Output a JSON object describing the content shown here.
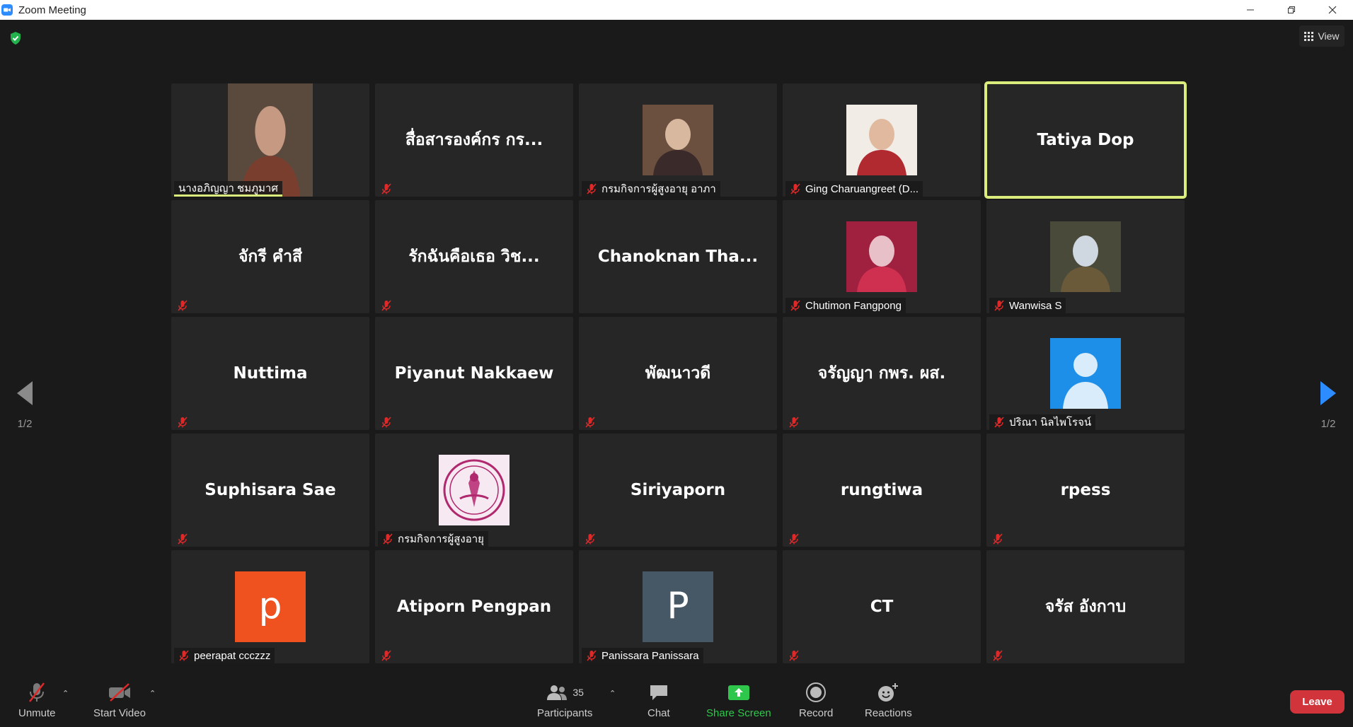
{
  "window": {
    "title": "Zoom Meeting"
  },
  "top": {
    "view_label": "View"
  },
  "pagination": {
    "prev_page": "1/2",
    "next_page": "1/2"
  },
  "tiles": [
    {
      "type": "video",
      "label": "นางอภิญญา ชมภูมาศ",
      "muted": false
    },
    {
      "type": "name",
      "name": "สื่อสารองค์กร กร...",
      "muted": true
    },
    {
      "type": "video",
      "label": "กรมกิจการผู้สูงอายุ อาภา",
      "muted": true
    },
    {
      "type": "video",
      "label": "Ging Charuangreet (D...",
      "muted": true
    },
    {
      "type": "name",
      "name": "Tatiya Dop",
      "muted": false,
      "active": true
    },
    {
      "type": "name",
      "name": "จักรี คำสี",
      "muted": true
    },
    {
      "type": "name",
      "name": "รักฉันคือเธอ วิช...",
      "muted": true
    },
    {
      "type": "name",
      "name": "Chanoknan  Tha...",
      "muted": false
    },
    {
      "type": "video",
      "label": "Chutimon Fangpong",
      "muted": true
    },
    {
      "type": "video",
      "label": "Wanwisa S",
      "muted": true
    },
    {
      "type": "name",
      "name": "Nuttima",
      "muted": true
    },
    {
      "type": "name",
      "name": "Piyanut Nakkaew",
      "muted": true
    },
    {
      "type": "name",
      "name": "พัฒนาวดี",
      "muted": true
    },
    {
      "type": "name",
      "name": "จรัญญา  กพร. ผส.",
      "muted": true
    },
    {
      "type": "avatar-default",
      "label": "ปริณา นิลไพโรจน์",
      "muted": true
    },
    {
      "type": "name",
      "name": "Suphisara Sae",
      "muted": true
    },
    {
      "type": "logo",
      "label": "กรมกิจการผู้สูงอายุ",
      "muted": true
    },
    {
      "type": "name",
      "name": "Siriyaporn",
      "muted": true
    },
    {
      "type": "name",
      "name": "rungtiwa",
      "muted": true
    },
    {
      "type": "name",
      "name": "rpess",
      "muted": true
    },
    {
      "type": "letter",
      "letter": "p",
      "color": "#f0521f",
      "label": "peerapat ccczzz",
      "muted": true
    },
    {
      "type": "name",
      "name": "Atiporn Pengpan",
      "muted": true
    },
    {
      "type": "letter",
      "letter": "P",
      "color": "#465766",
      "label": "Panissara Panissara",
      "muted": true
    },
    {
      "type": "name",
      "name": "CT",
      "muted": true
    },
    {
      "type": "name",
      "name": "จรัส อังกาบ",
      "muted": true
    }
  ],
  "toolbar": {
    "unmute_label": "Unmute",
    "start_video_label": "Start Video",
    "participants_label": "Participants",
    "participants_count": "35",
    "chat_label": "Chat",
    "share_screen_label": "Share Screen",
    "record_label": "Record",
    "reactions_label": "Reactions",
    "leave_label": "Leave"
  },
  "colors": {
    "accent": "#2d8cff",
    "share_green": "#2ec74b",
    "active_border": "#d9ec7c",
    "leave_red": "#d1343b",
    "muted_red": "#e02828"
  }
}
